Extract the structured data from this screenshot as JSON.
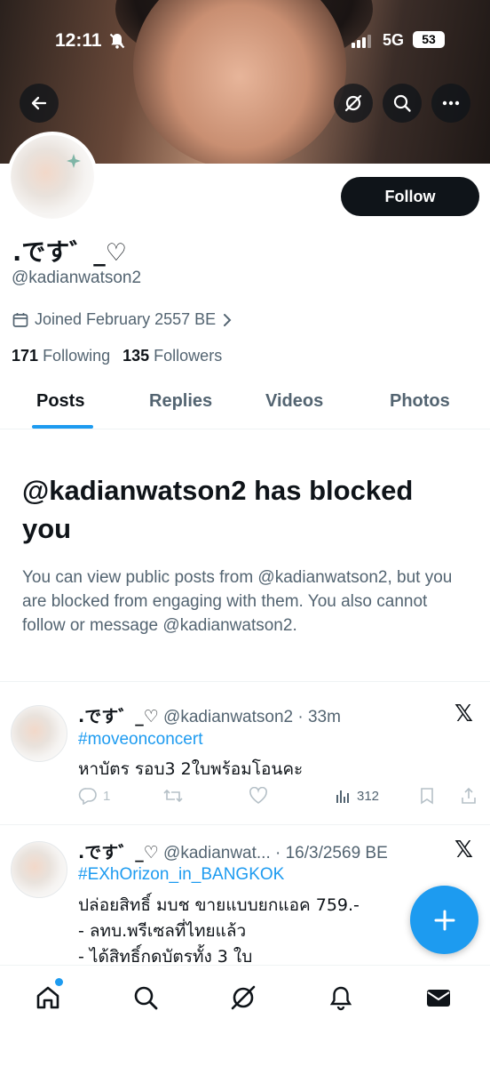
{
  "status_bar": {
    "time": "12:11",
    "network": "5G",
    "battery": "53"
  },
  "header": {
    "back_icon": "back-arrow-icon",
    "grok_icon": "grok-icon",
    "search_icon": "search-icon",
    "more_icon": "more-icon"
  },
  "profile": {
    "display_name": ".です゛_♡",
    "handle": "@kadianwatson2",
    "joined": "Joined February 2557 BE",
    "following_count": "171",
    "following_label": "Following",
    "followers_count": "135",
    "followers_label": "Followers",
    "follow_label": "Follow"
  },
  "tabs": [
    "Posts",
    "Replies",
    "Videos",
    "Photos"
  ],
  "blocked": {
    "title": "@kadianwatson2 has blocked you",
    "message": "You can view public posts from @kadianwatson2, but you are blocked from engaging with them. You also cannot follow or message @kadianwatson2."
  },
  "posts": [
    {
      "name": ".です゛_♡",
      "meta": "@kadianwatson2 · 33m",
      "hashtag": "#moveonconcert",
      "lines": [
        "หาบัตร รอบ3 2ใบพร้อมโอนคะ"
      ],
      "replies": "1",
      "views": "312"
    },
    {
      "name": ".です゛_♡",
      "meta": "@kadianwat... · 16/3/2569 BE",
      "hashtag": "#EXhOrizon_in_BANGKOK",
      "lines": [
        "ปล่อยสิทธิ์ มบช ขายแบบยกแอค 759.-",
        "- ลทบ.พรีเซลที่ไทยแล้ว",
        "- ได้สิทธิ์กดบัตรทั้ง 3 ใบ"
      ]
    }
  ],
  "colors": {
    "accent": "#1d9bf0",
    "text": "#0f1419",
    "muted": "#536471"
  }
}
